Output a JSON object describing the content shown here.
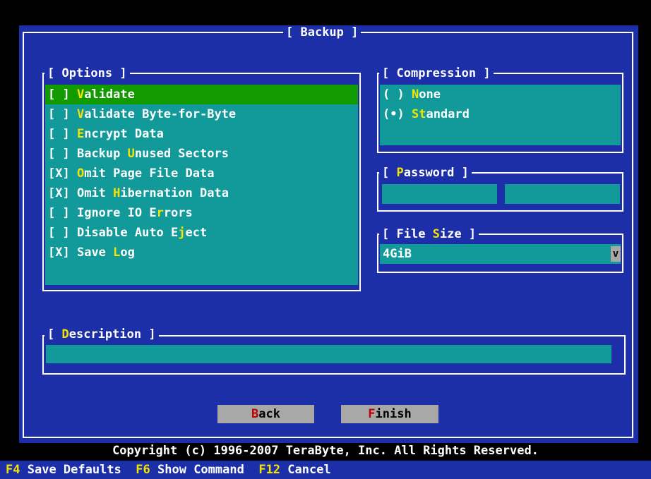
{
  "dialog": {
    "title": "Backup"
  },
  "options": {
    "title": "Options",
    "items": [
      {
        "check": "[ ]",
        "pre": "",
        "hot": "V",
        "post": "alidate",
        "selected": true
      },
      {
        "check": "[ ]",
        "pre": "",
        "hot": "V",
        "post": "alidate Byte-for-Byte",
        "selected": false
      },
      {
        "check": "[ ]",
        "pre": "",
        "hot": "E",
        "post": "ncrypt Data",
        "selected": false
      },
      {
        "check": "[ ]",
        "pre": "Backup ",
        "hot": "U",
        "post": "nused Sectors",
        "selected": false
      },
      {
        "check": "[X]",
        "pre": "",
        "hot": "O",
        "post": "mit Page File Data",
        "selected": false
      },
      {
        "check": "[X]",
        "pre": "Omit ",
        "hot": "H",
        "post": "ibernation Data",
        "selected": false
      },
      {
        "check": "[ ]",
        "pre": "Ignore IO E",
        "hot": "r",
        "post": "rors",
        "selected": false
      },
      {
        "check": "[ ]",
        "pre": "Disable Auto E",
        "hot": "j",
        "post": "ect",
        "selected": false
      },
      {
        "check": "[X]",
        "pre": "Save ",
        "hot": "L",
        "post": "og",
        "selected": false
      }
    ]
  },
  "compression": {
    "title": "Compression",
    "items": [
      {
        "radio": "( )",
        "pre": "",
        "hot": "N",
        "post": "one"
      },
      {
        "radio": "(•)",
        "pre": "",
        "hot": "St",
        "post": "andard"
      }
    ]
  },
  "password": {
    "title_pre": "",
    "title_hot": "P",
    "title_post": "assword"
  },
  "file_size": {
    "title_pre": "File ",
    "title_hot": "S",
    "title_post": "ize",
    "value": "4GiB",
    "dropdown_glyph": "v"
  },
  "description": {
    "title_pre": "",
    "title_hot": "D",
    "title_post": "escription",
    "value": ""
  },
  "buttons": {
    "back": {
      "hot": "B",
      "post": "ack"
    },
    "finish": {
      "hot": "F",
      "post": "inish"
    }
  },
  "copyright": "Copyright (c) 1996-2007 TeraByte, Inc.  All Rights Reserved.",
  "statusbar": [
    {
      "key": "F4",
      "label": "Save Defaults"
    },
    {
      "key": "F6",
      "label": "Show Command"
    },
    {
      "key": "F12",
      "label": "Cancel"
    }
  ],
  "colors": {
    "background": "#1c2fa8",
    "field": "#129a9a",
    "selection": "#129b00",
    "hotkey": "#f4e400",
    "button": "#a8a8a8",
    "button_hotkey": "#c00000"
  }
}
